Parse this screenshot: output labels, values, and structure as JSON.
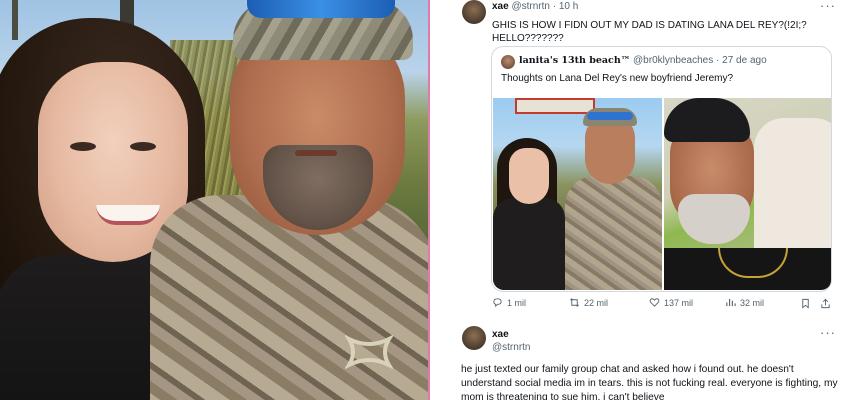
{
  "tweet1": {
    "name": "xae",
    "handle": "@strnrtn",
    "separator": "·",
    "time": "10 h",
    "more": "···",
    "text": "GHIS IS HOW I FIDN OUT MY DAD IS DATING LANA DEL REY?(!2I;? HELLO???????"
  },
  "quote": {
    "name": "lanita's 13th beach™",
    "handle": "@br0klynbeaches",
    "separator": "·",
    "date": "27 de ago",
    "text": "Thoughts on Lana Del Rey's new boyfriend Jeremy?"
  },
  "actions": {
    "replies": "1 mil",
    "retweets": "22 mil",
    "likes": "137 mil",
    "views": "32 mil"
  },
  "tweet2": {
    "name": "xae",
    "handle": "@strnrtn",
    "more": "···",
    "text": "he just texted our family group chat and asked how i found out. he doesn't understand social media im in tears. this is not fucking real. everyone is fighting, my mom is threatening to sue him, i can't believe"
  },
  "colors": {
    "divider": "#e07aa8",
    "text": "#0f1419",
    "muted": "#536471",
    "border": "#cfd9de"
  },
  "icons": [
    "reply-icon",
    "retweet-icon",
    "like-icon",
    "views-icon",
    "bookmark-icon",
    "share-icon",
    "more-icon"
  ]
}
